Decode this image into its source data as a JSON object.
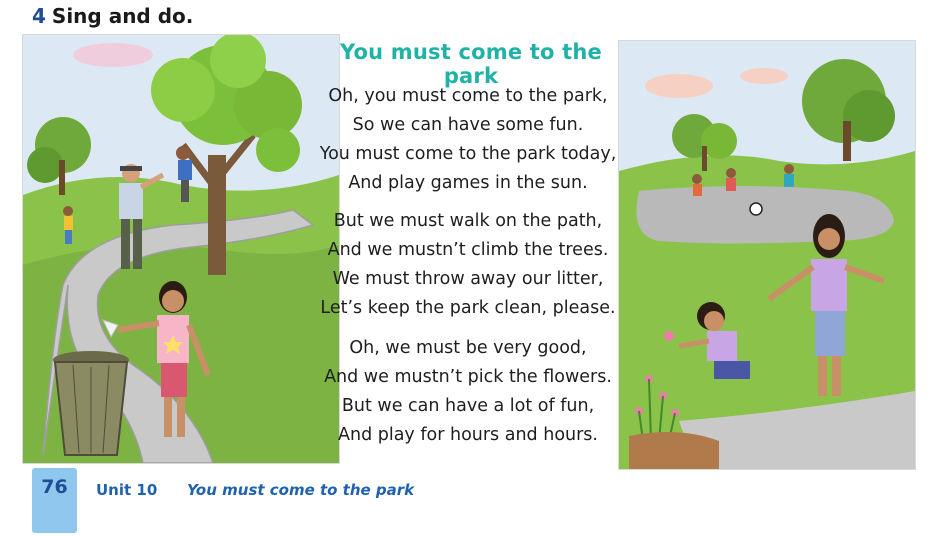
{
  "exercise": {
    "number": "4",
    "instruction": "Sing and do."
  },
  "song": {
    "title": "You must come to the park",
    "verses": [
      [
        "Oh, you must come to the park,",
        "So we can have some fun.",
        "You must come to the park today,",
        "And play games in the sun."
      ],
      [
        "But we must walk on the path,",
        "And we mustn’t climb the trees.",
        "We must throw away our litter,",
        "Let’s keep the park clean, please."
      ],
      [
        "Oh, we must be very good,",
        "And we mustn’t pick the flowers.",
        "But we can have a lot of fun,",
        "And play for hours and hours."
      ]
    ]
  },
  "footer": {
    "page_number": "76",
    "unit": "Unit 10",
    "unit_title": "You must come to the park"
  },
  "colors": {
    "title_teal": "#20b2a6",
    "footer_blue": "#1f62b0",
    "page_tab": "#8fc7ee",
    "heading_number": "#1f4e96"
  }
}
